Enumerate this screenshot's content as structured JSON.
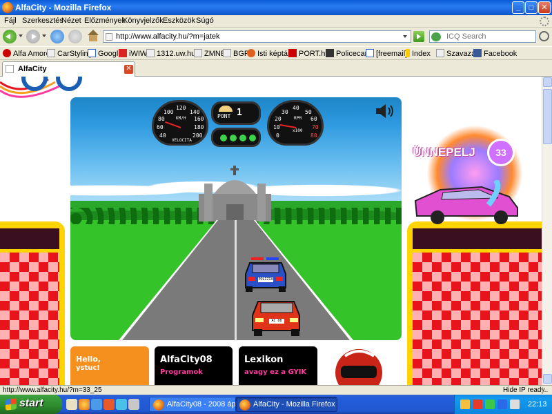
{
  "window": {
    "title": "AlfaCity - Mozilla Firefox",
    "controls": {
      "minimize": "_",
      "maximize": "□",
      "close": "✕"
    }
  },
  "menu": [
    "Fájl",
    "Szerkesztés",
    "Nézet",
    "Előzmények",
    "Könyvjelzők",
    "Eszközök",
    "Súgó"
  ],
  "nav": {
    "url": "http://www.alfacity.hu/?m=jatek",
    "search_placeholder": "ICQ Search"
  },
  "bookmarks": [
    "Alfa Amore",
    "CarStyling",
    "Google",
    "iWIW",
    "1312.uw.hu",
    "ZMNE",
    "BGF",
    "Isti képtár",
    "PORT.hu",
    "Policecars",
    "[freemail]",
    "Index",
    "Szavazás",
    "Facebook"
  ],
  "tab": {
    "label": "AlfaCity",
    "close": "✕"
  },
  "game": {
    "point_label": "PONT",
    "point_value": "1",
    "speedometer": {
      "unit": "KM/H",
      "caption": "VELOCITA",
      "ticks": [
        "40",
        "60",
        "80",
        "100",
        "120",
        "140",
        "160",
        "180",
        "200"
      ]
    },
    "tachometer": {
      "unit": "RPM",
      "caption": "x100",
      "ticks": [
        "0",
        "10",
        "20",
        "30",
        "40",
        "50",
        "60",
        "70",
        "80"
      ]
    },
    "lights_count": 4,
    "police_plate": "POLIZIA",
    "player_plate": "AC 08"
  },
  "banner": {
    "text": "ÜNNEPELJ",
    "badge": "33"
  },
  "cards": [
    {
      "title": "Hello,",
      "subtitle": "ystuc!"
    },
    {
      "title": "AlfaCity08",
      "subtitle": "Programok"
    },
    {
      "title": "Lexikon",
      "subtitle": "avagy ez a GYIK"
    }
  ],
  "status": {
    "left": "http://www.alfacity.hu/?m=33_25",
    "right": "Hide IP ready.."
  },
  "taskbar": {
    "start": "start",
    "tasks": [
      "AlfaCity08 - 2008 ápr...",
      "AlfaCity - Mozilla Firefox"
    ],
    "clock": "22:13"
  },
  "colors": {
    "title_bar": "#0a5bd6",
    "taskbar": "#245edb",
    "start_button": "#3da33d",
    "checker_red": "#e8141c",
    "card_orange": "#f5901e",
    "card_pink": "#ff3ca0"
  }
}
